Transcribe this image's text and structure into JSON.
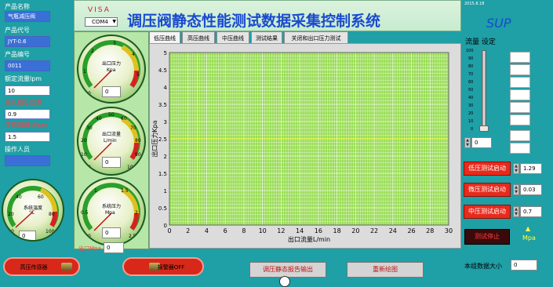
{
  "product": {
    "name_label": "产品名称",
    "name_value": "气瓶减压阀",
    "code_label": "产品代号",
    "code_value": "JYT-0.6",
    "serial_label": "产品编号",
    "serial_value": "0011",
    "rated_flow_label": "额定流量lpm",
    "rated_flow_value": "10",
    "max_ratio_label": "最长稳压倍数",
    "max_ratio_value": "0.9",
    "gain_label": "传感器增益lpm",
    "gain_value": "1.5",
    "operator_label": "操作人员",
    "operator_value": ""
  },
  "header": {
    "visa_label": "VISA",
    "visa_port": "COM4",
    "title": "调压阀静态性能测试数据采集控制系统",
    "version": "2015.8.18",
    "logo": "SUP"
  },
  "gauges": {
    "outlet_pressure": {
      "label": "出口压力",
      "unit": "Kpa",
      "value": "0",
      "ticks": [
        "0",
        "1",
        "2",
        "3",
        "4",
        "5"
      ]
    },
    "outlet_flow": {
      "label": "出口流量",
      "unit": "L/min",
      "value": "0",
      "ticks": [
        "0",
        "10",
        "20",
        "30",
        "40",
        "50",
        "60",
        "70",
        "80",
        "90",
        "100"
      ]
    },
    "system_pressure": {
      "label": "系统压力",
      "unit": "Mpa",
      "value": "0",
      "ticks": [
        "0",
        "0.5",
        "1",
        "1.5",
        "2",
        "2.5"
      ]
    },
    "system_temp": {
      "label": "系统温度",
      "unit": "°C",
      "value": "0",
      "ticks": [
        "0",
        "20",
        "40",
        "60",
        "80",
        "100"
      ]
    },
    "outlet_mpa_label": "出口Mpa",
    "outlet_mpa_value": "0"
  },
  "tabs": [
    "低压曲线",
    "高压曲线",
    "中压曲线",
    "测试结果",
    "关闭和出口压力测试"
  ],
  "chart_data": {
    "type": "line",
    "xlabel": "出口流量L/min",
    "ylabel": "出口压力Kpa",
    "xlim": [
      0,
      30
    ],
    "ylim": [
      0,
      5
    ],
    "xticks": [
      "0",
      "2",
      "4",
      "6",
      "8",
      "10",
      "12",
      "14",
      "16",
      "18",
      "20",
      "22",
      "24",
      "26",
      "28",
      "30"
    ],
    "yticks": [
      "0",
      "0.5",
      "1",
      "1.5",
      "2",
      "2.5",
      "3",
      "3.5",
      "4",
      "4.5",
      "5"
    ],
    "grid": true,
    "cursor_x": 3,
    "cursor_y": 2.5,
    "series": []
  },
  "right_panel": {
    "flow_setting_label": "流量 设定",
    "slider_ticks": [
      "100",
      "90",
      "80",
      "70",
      "60",
      "50",
      "40",
      "30",
      "20",
      "10",
      "0"
    ],
    "slider_value": 0,
    "slider_input": "0",
    "low_button": "低压测试启动",
    "low_value": "1.29",
    "micro_button": "微压测试启动",
    "micro_value": "0.03",
    "mid_button": "中压测试启动",
    "mid_value": "0.7",
    "stop_button": "测试停止",
    "unit_mpa": "Mpa",
    "batch_label": "本组数据大小",
    "batch_value": "0"
  },
  "bottom": {
    "sensor_toggle": "高压传感器",
    "alarm_toggle": "报警器OFF",
    "report_button": "调压静态报告输出",
    "redraw_button": "重新绘图"
  },
  "colors": {
    "background": "#1f9fa6",
    "chart_bg": "#99dd55",
    "grid": "#ffffff",
    "cursor": "#ffff33",
    "button_red": "#e82a1c"
  }
}
